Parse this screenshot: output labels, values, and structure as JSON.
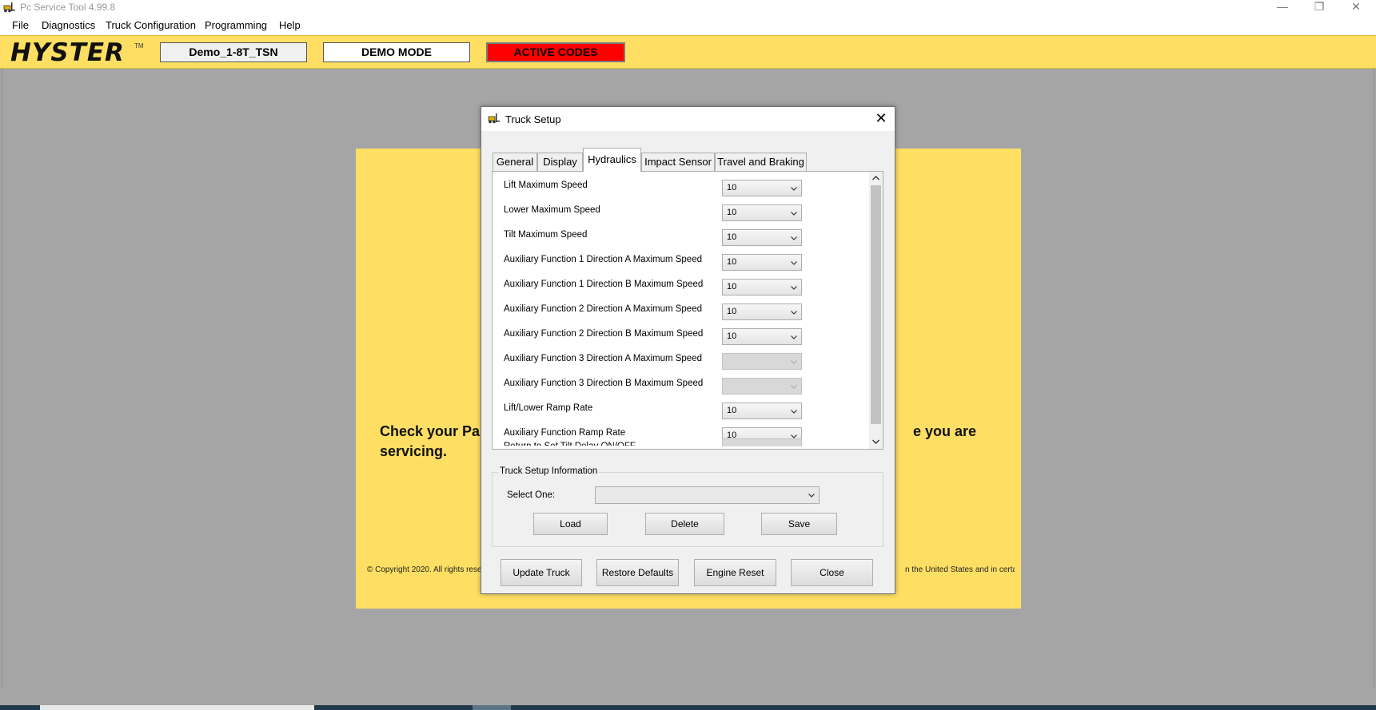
{
  "app": {
    "title": "Pc Service Tool 4.99.8",
    "window_controls": {
      "minimize": "—",
      "restore": "❐",
      "close": "✕"
    }
  },
  "menu": {
    "items": [
      "File",
      "Diagnostics",
      "Truck Configuration",
      "Programming",
      "Help"
    ]
  },
  "header": {
    "logo": "HYSTER",
    "logo_tm": "TM",
    "truck_id": "Demo_1-8T_TSN",
    "mode": "DEMO MODE",
    "active_codes": "ACTIVE CODES",
    "colors": {
      "brand_yellow": "#fedf63",
      "active_codes_red": "#ff0000"
    }
  },
  "background_panel": {
    "message_left": "Check your Par",
    "message_right": "e you are",
    "message_line2": "servicing.",
    "copyright_left": "© Copyright 2020. All rights rese",
    "copyright_right": "n the United States and in certain"
  },
  "dialog": {
    "title": "Truck Setup",
    "close_glyph": "✕",
    "tabs": [
      {
        "label": "General",
        "active": false
      },
      {
        "label": "Display",
        "active": false
      },
      {
        "label": "Hydraulics",
        "active": true
      },
      {
        "label": "Impact Sensor",
        "active": false
      },
      {
        "label": "Travel and Braking",
        "active": false
      }
    ],
    "settings": [
      {
        "label": "Lift Maximum Speed",
        "value": "10",
        "enabled": true
      },
      {
        "label": "Lower Maximum Speed",
        "value": "10",
        "enabled": true
      },
      {
        "label": "Tilt Maximum Speed",
        "value": "10",
        "enabled": true
      },
      {
        "label": "Auxiliary Function 1 Direction A Maximum Speed",
        "value": "10",
        "enabled": true
      },
      {
        "label": "Auxiliary Function 1 Direction B Maximum Speed",
        "value": "10",
        "enabled": true
      },
      {
        "label": "Auxiliary Function 2 Direction A Maximum Speed",
        "value": "10",
        "enabled": true
      },
      {
        "label": "Auxiliary Function 2 Direction B Maximum Speed",
        "value": "10",
        "enabled": true
      },
      {
        "label": "Auxiliary Function 3 Direction A Maximum Speed",
        "value": "",
        "enabled": false
      },
      {
        "label": "Auxiliary Function 3 Direction B Maximum Speed",
        "value": "",
        "enabled": false
      },
      {
        "label": "Lift/Lower Ramp Rate",
        "value": "10",
        "enabled": true
      },
      {
        "label": "Auxiliary Function Ramp Rate",
        "value": "10",
        "enabled": true
      }
    ],
    "clipped_row_label": "Return to Set Tilt Delay ON/OFF",
    "info": {
      "title": "Truck Setup Information",
      "select_label": "Select One:",
      "select_value": "",
      "buttons": [
        "Load",
        "Delete",
        "Save"
      ]
    },
    "footer_buttons": [
      "Update Truck",
      "Restore Defaults",
      "Engine Reset",
      "Close"
    ]
  }
}
